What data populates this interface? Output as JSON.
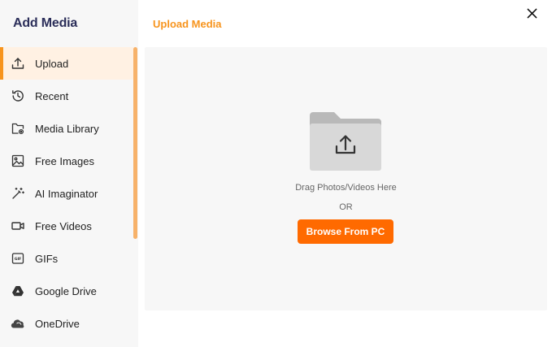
{
  "sidebar": {
    "title": "Add Media",
    "items": [
      {
        "label": "Upload",
        "icon": "upload-icon",
        "active": true
      },
      {
        "label": "Recent",
        "icon": "history-icon"
      },
      {
        "label": "Media Library",
        "icon": "folder-gear-icon"
      },
      {
        "label": "Free Images",
        "icon": "image-icon"
      },
      {
        "label": "AI Imaginator",
        "icon": "magic-wand-icon"
      },
      {
        "label": "Free Videos",
        "icon": "video-camera-icon"
      },
      {
        "label": "GIFs",
        "icon": "gif-icon"
      },
      {
        "label": "Google Drive",
        "icon": "google-drive-icon"
      },
      {
        "label": "OneDrive",
        "icon": "onedrive-icon"
      }
    ]
  },
  "header": {
    "title": "Upload Media"
  },
  "dropzone": {
    "drag_text": "Drag Photos/Videos Here",
    "or_text": "OR",
    "browse_label": "Browse From PC"
  },
  "colors": {
    "accent": "#f7941d",
    "button": "#ff6a00",
    "title": "#2c2f5a"
  }
}
